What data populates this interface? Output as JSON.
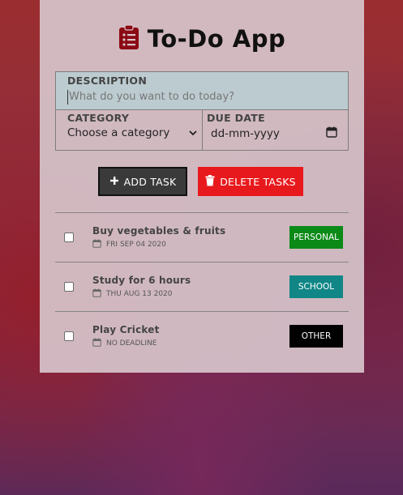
{
  "app": {
    "title": "To-Do App",
    "icon": "clipboard-list-icon",
    "accent": "#8b0a14"
  },
  "form": {
    "description_label": "DESCRIPTION",
    "description_placeholder": "What do you want to do today?",
    "category_label": "CATEGORY",
    "category_value": "Choose a category",
    "due_label": "DUE DATE",
    "due_value": "dd-mm-yyyy"
  },
  "actions": {
    "add_label": "ADD TASK",
    "delete_label": "DELETE TASKS",
    "add_color": "#3a3a3a",
    "delete_color": "#e8191c"
  },
  "tasks": [
    {
      "title": "Buy vegetables & fruits",
      "date": "FRI SEP 04 2020",
      "category": "PERSONAL",
      "color": "#0b8a18"
    },
    {
      "title": "Study for 6 hours",
      "date": "THU AUG 13 2020",
      "category": "SCHOOL",
      "color": "#118686"
    },
    {
      "title": "Play Cricket",
      "date": "NO DEADLINE",
      "category": "OTHER",
      "color": "#000000"
    }
  ]
}
